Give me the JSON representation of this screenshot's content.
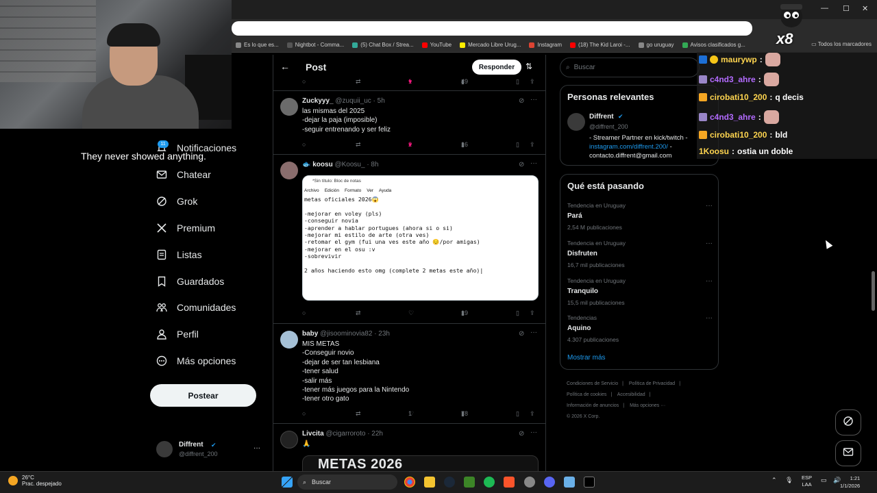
{
  "browser": {
    "bookmarks": [
      {
        "label": "Es lo que es...",
        "color": "#888"
      },
      {
        "label": "Nightbot - Comma...",
        "color": "#555"
      },
      {
        "label": "(5) Chat Box / Strea...",
        "color": "#3a9"
      },
      {
        "label": "YouTube",
        "color": "#f00"
      },
      {
        "label": "Mercado Libre Urug...",
        "color": "#fe0"
      },
      {
        "label": "Instagram",
        "color": "#d43"
      },
      {
        "label": "(18) The Kid Laroi -...",
        "color": "#f00"
      },
      {
        "label": "go uruguay",
        "color": "#888"
      },
      {
        "label": "Avisos clasificados g...",
        "color": "#3a5"
      }
    ],
    "all_bookmarks": "Todos los marcadores"
  },
  "stream": {
    "subtitle": "They never showed anything.",
    "overlay_counter": "x8"
  },
  "nav": {
    "notif_badge": "11",
    "items": [
      {
        "label": "Notificaciones",
        "icon": "bell-icon"
      },
      {
        "label": "Chatear",
        "icon": "mail-icon"
      },
      {
        "label": "Grok",
        "icon": "grok-icon"
      },
      {
        "label": "Premium",
        "icon": "x-logo-icon"
      },
      {
        "label": "Listas",
        "icon": "list-icon"
      },
      {
        "label": "Guardados",
        "icon": "bookmark-icon"
      },
      {
        "label": "Comunidades",
        "icon": "communities-icon"
      },
      {
        "label": "Perfil",
        "icon": "person-icon"
      },
      {
        "label": "Más opciones",
        "icon": "more-circle-icon"
      }
    ],
    "post_button": "Postear",
    "profile": {
      "name": "Diffrent",
      "handle": "@diffrent_200",
      "more": "···"
    }
  },
  "post": {
    "title": "Post",
    "reply_button": "Responder",
    "top_actions": {
      "likes": "1",
      "views": "49"
    },
    "tweets": [
      {
        "name": "Zuckyyy_",
        "handle": "@zuquii_uc · 5h",
        "text": "las mismas del 2025\n-dejar la paja (imposible)\n-seguir entrenando y ser feliz",
        "likes": "2",
        "liked": true,
        "views": "16"
      },
      {
        "name": "koosu",
        "handle": "@Koosu_ · 8h",
        "text": "",
        "likes": "",
        "liked": false,
        "views": "19",
        "notepad": {
          "title": "*Sin título: Bloc de notas",
          "menu": [
            "Archivo",
            "Edición",
            "Formato",
            "Ver",
            "Ayuda"
          ],
          "text": "metas oficiales 2026😱\n\n-mejorar en voley (pls)\n-conseguir novia\n-aprender a hablar portugues (ahora si o si)\n-mejorar mi estilo de arte (otra ves)\n-retomar el gym (fui una ves este año 😔/por amigas)\n-mejorar en el osu :v\n-sobrevivir\n\n2 años haciendo esto omg (complete 2 metas este año)|"
        }
      },
      {
        "name": "baby",
        "handle": "@jisoominovia82 · 23h",
        "text": "MIS METAS\n-Conseguir novio\n-dejar de ser tan lesbiana\n-tener salud\n-salir más\n-tener más juegos para la Nintendo\n-tener otro gato",
        "likes": "1",
        "liked": false,
        "views": "78"
      },
      {
        "name": "Livcita",
        "handle": "@cigarroroto · 22h",
        "text": "🙏",
        "image_title": "METAS 2026"
      }
    ]
  },
  "right": {
    "search_placeholder": "Buscar",
    "relevant": {
      "title": "Personas relevantes",
      "name": "Diffrent",
      "handle": "@diffrent_200",
      "bio1": "- Streamer Partner en kick/twitch -",
      "bio_link": "instagram.com/diffrent.200/",
      "bio_link_suffix": " -",
      "bio2": "contacto.diffrent@gmail.com"
    },
    "trends": {
      "title": "Qué está pasando",
      "items": [
        {
          "context": "Tendencia en Uruguay",
          "name": "Pará",
          "count": "2,54 M publicaciones"
        },
        {
          "context": "Tendencia en Uruguay",
          "name": "Disfruten",
          "count": "16,7 mil publicaciones"
        },
        {
          "context": "Tendencia en Uruguay",
          "name": "Tranquilo",
          "count": "15,5 mil publicaciones"
        },
        {
          "context": "Tendencias",
          "name": "Aquino",
          "count": "4.307 publicaciones"
        }
      ],
      "show_more": "Mostrar más"
    },
    "footer": {
      "l1": "Condiciones de Servicio",
      "l2": "Política de Privacidad",
      "l3": "Política de cookies",
      "l4": "Accesibilidad",
      "l5": "Información de anuncios",
      "l6": "Más opciones ···",
      "copyright": "© 2026 X Corp."
    }
  },
  "chat": [
    {
      "user": "maurywp",
      "color": "#ffd54f",
      "msg": "",
      "emote": true
    },
    {
      "user": "c4nd3_ahre",
      "color": "#b36bff",
      "msg": "",
      "emote": true
    },
    {
      "user": "cirobati10_200",
      "color": "#ffd54f",
      "msg": "q decis",
      "emote": false
    },
    {
      "user": "c4nd3_ahre",
      "color": "#b36bff",
      "msg": "",
      "emote": true
    },
    {
      "user": "cirobati10_200",
      "color": "#ffd54f",
      "msg": "bld",
      "emote": false
    },
    {
      "user": "1Koosu",
      "color": "#ffd54f",
      "msg": "ostia un doble",
      "emote": false
    }
  ],
  "taskbar": {
    "temperature": "26°C",
    "weather": "Prac. despejado",
    "search": "Buscar",
    "lang1": "ESP",
    "lang2": "LAA",
    "time": "1:21",
    "date": "1/1/2026"
  }
}
